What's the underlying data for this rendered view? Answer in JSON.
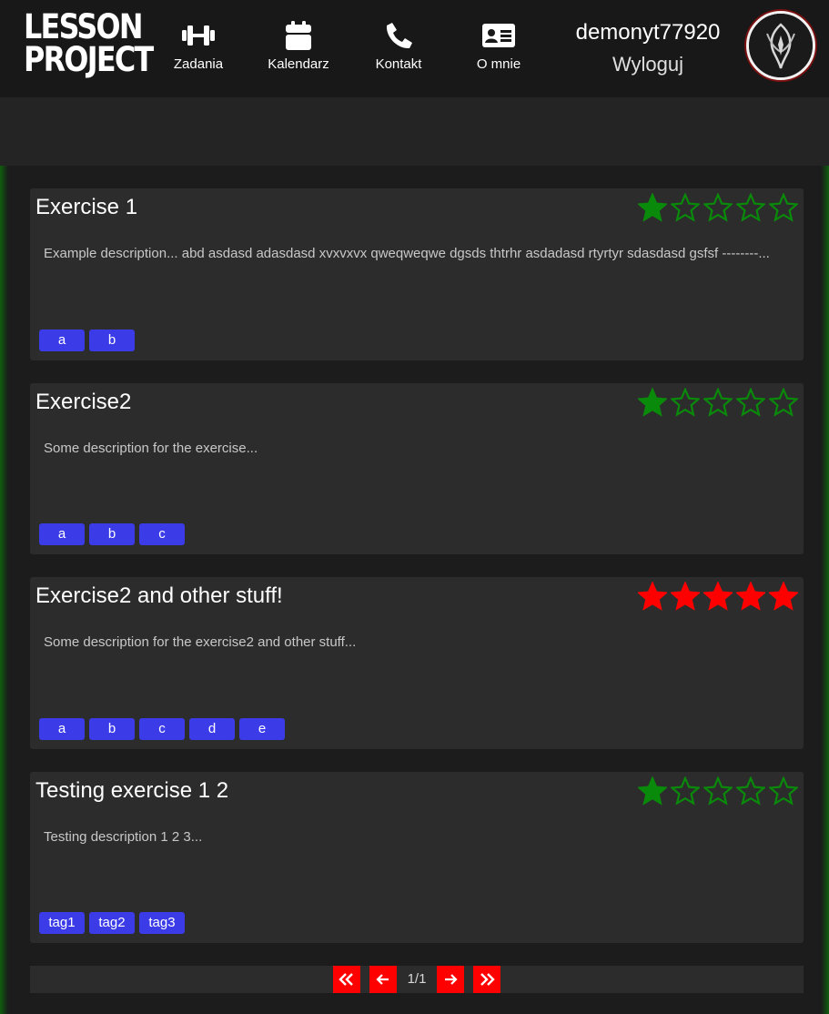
{
  "header": {
    "logo_line1": "LESSON",
    "logo_line2": "PROJECT",
    "nav": [
      {
        "label": "Zadania",
        "icon": "dumbbell-icon"
      },
      {
        "label": "Kalendarz",
        "icon": "calendar-icon"
      },
      {
        "label": "Kontakt",
        "icon": "phone-icon"
      },
      {
        "label": "O mnie",
        "icon": "id-card-icon"
      }
    ],
    "username": "demonyt77920",
    "logout_label": "Wyloguj"
  },
  "exercises": [
    {
      "title": "Exercise 1",
      "rating": 1,
      "star_color": "#0a8a0a",
      "description": "Example description... abd asdasd adasdasd xvxvxvx qweqweqwe dgsds thtrhr asdadasd rtyrtyr sdasdasd gsfsf --------...",
      "tags": [
        "a",
        "b"
      ]
    },
    {
      "title": "Exercise2",
      "rating": 1,
      "star_color": "#0a8a0a",
      "description": "Some description for the exercise...",
      "tags": [
        "a",
        "b",
        "c"
      ]
    },
    {
      "title": "Exercise2 and other stuff!",
      "rating": 5,
      "star_color": "#ff0000",
      "description": "Some description for the exercise2 and other stuff...",
      "tags": [
        "a",
        "b",
        "c",
        "d",
        "e"
      ]
    },
    {
      "title": "Testing exercise 1 2",
      "rating": 1,
      "star_color": "#0a8a0a",
      "description": "Testing description 1 2 3...",
      "tags": [
        "tag1",
        "tag2",
        "tag3"
      ]
    }
  ],
  "pagination": {
    "page_info": "1/1"
  },
  "colors": {
    "accent_red": "#ff0000",
    "tag_blue": "#3b3be8",
    "star_green": "#0a8a0a"
  }
}
